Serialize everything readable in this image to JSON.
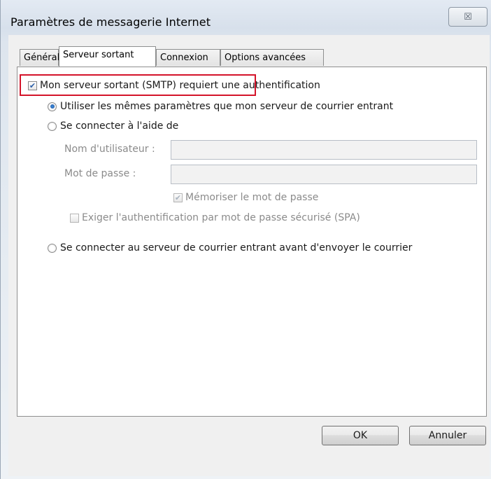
{
  "window": {
    "title": "Paramètres de messagerie Internet",
    "close_glyph": "☒"
  },
  "tabs": [
    {
      "label": "Général"
    },
    {
      "label": "Serveur sortant"
    },
    {
      "label": "Connexion"
    },
    {
      "label": "Options avancées"
    }
  ],
  "active_tab": "Serveur sortant",
  "outgoing": {
    "smtp_auth": {
      "label": "Mon serveur sortant (SMTP) requiert une authentification",
      "checked": true
    },
    "use_same_settings": {
      "label": "Utiliser les mêmes paramètres que mon serveur de courrier entrant",
      "selected": true
    },
    "connect_using": {
      "label": "Se connecter à l'aide de",
      "selected": false
    },
    "username": {
      "label": "Nom d'utilisateur :",
      "value": ""
    },
    "password": {
      "label": "Mot de passe :",
      "value": ""
    },
    "remember_password": {
      "label": "Mémoriser le mot de passe",
      "checked": true,
      "disabled": true
    },
    "require_spa": {
      "label": "Exiger l'authentification par mot de passe sécurisé (SPA)",
      "checked": false,
      "disabled": true
    },
    "connect_incoming_first": {
      "label": "Se connecter au serveur de courrier entrant avant d'envoyer le courrier",
      "selected": false
    }
  },
  "buttons": {
    "ok": "OK",
    "cancel": "Annuler"
  },
  "colors": {
    "highlight_border": "#d4142a",
    "accent": "#2b5fa8"
  }
}
